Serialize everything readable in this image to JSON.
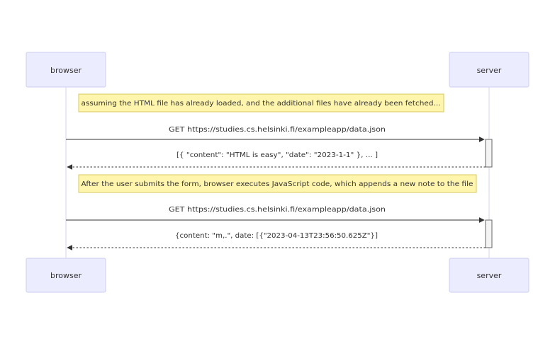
{
  "actors": {
    "browser": "browser",
    "server": "server"
  },
  "notes": [
    "assuming the HTML file has already loaded, and the additional files have already been fetched...",
    "After the user submits the form, browser executes JavaScript code, which appends a new note to the file"
  ],
  "messages": [
    {
      "from": "browser",
      "to": "server",
      "text": "GET https://studies.cs.helsinki.fi/exampleapp/data.json",
      "style": "solid"
    },
    {
      "from": "server",
      "to": "browser",
      "text": "[{ \"content\": \"HTML is easy\", \"date\": \"2023-1-1\" }, ... ]",
      "style": "dashed"
    },
    {
      "from": "browser",
      "to": "server",
      "text": "GET https://studies.cs.helsinki.fi/exampleapp/data.json",
      "style": "solid"
    },
    {
      "from": "server",
      "to": "browser",
      "text": "{content: \"m,.\", date: [{\"2023-04-13T23:56:50.625Z\"}]",
      "style": "dashed"
    }
  ],
  "colors": {
    "actor_fill": "#ececff",
    "actor_border": "#cdcdf3",
    "note_fill": "#fff5ad",
    "note_border": "#d9c85b",
    "line": "#333333"
  }
}
